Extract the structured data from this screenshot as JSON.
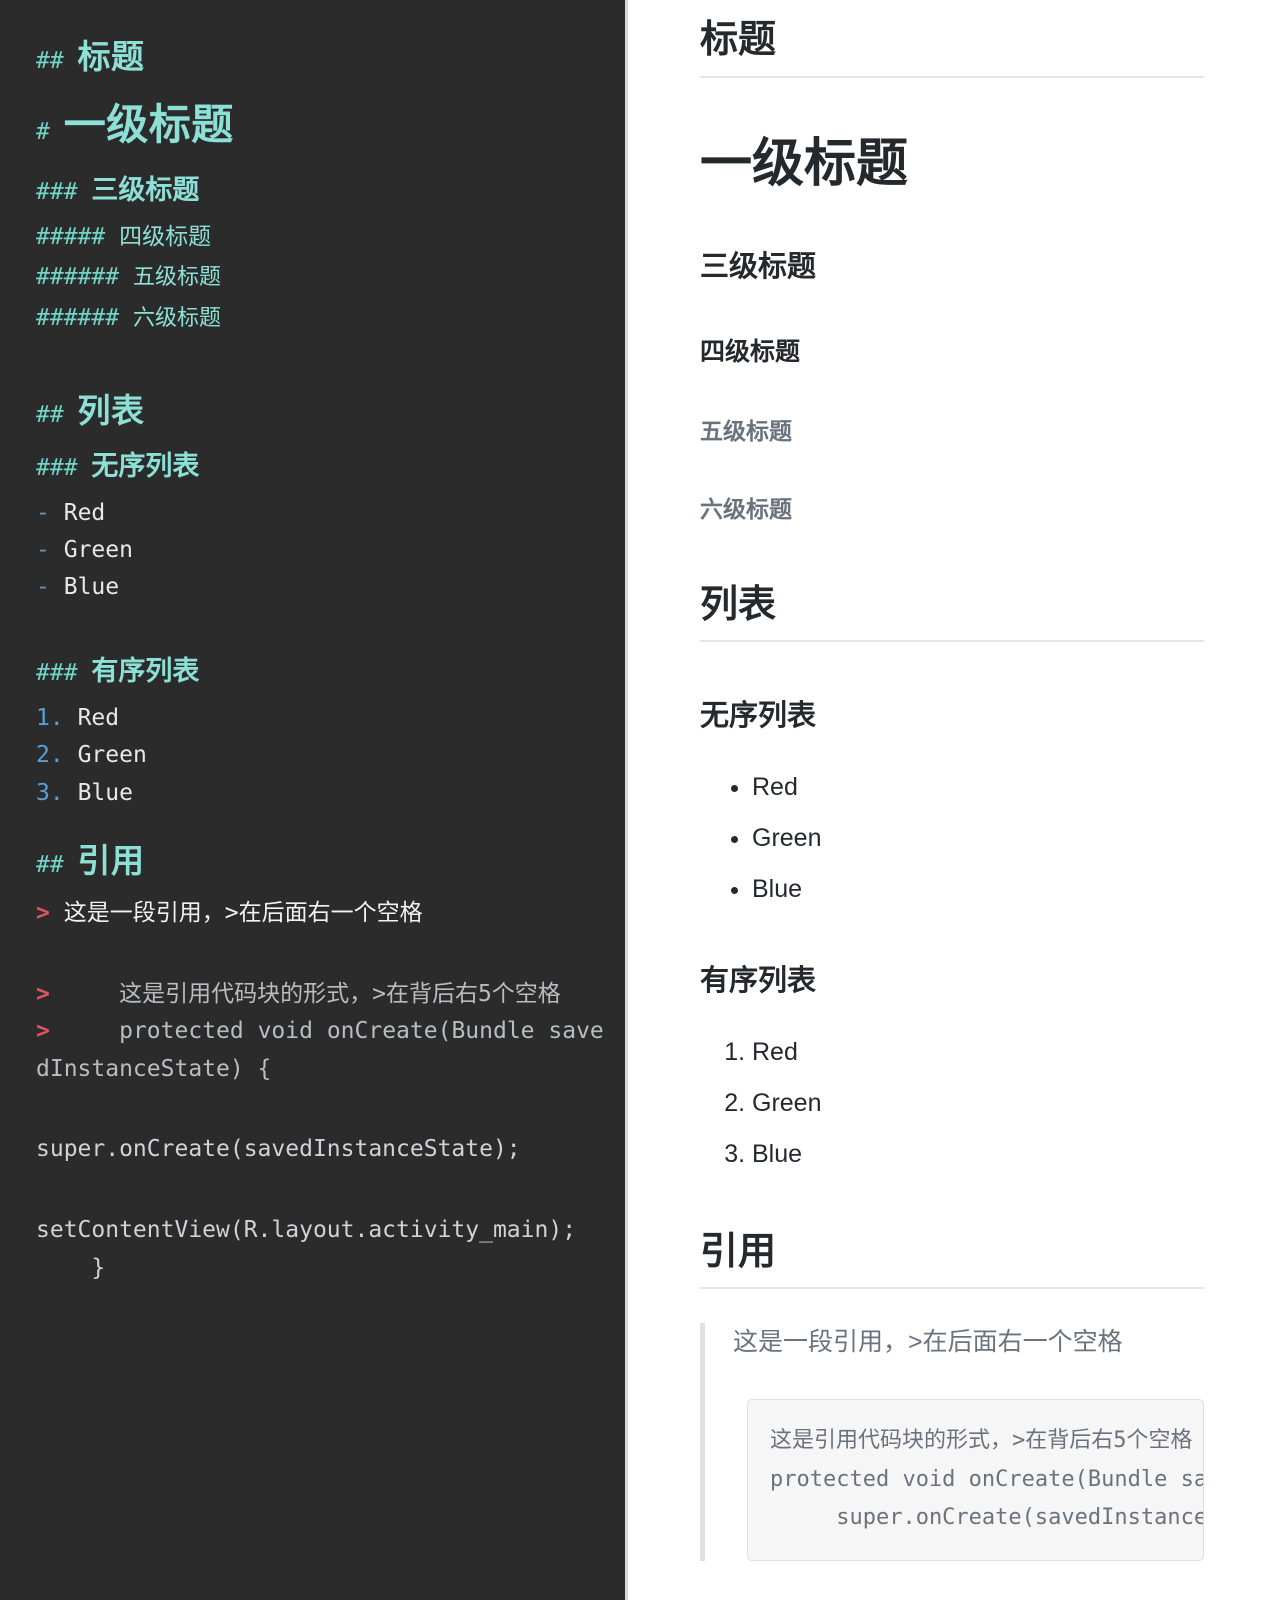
{
  "editor": {
    "theme_bg": "#2b2b2b",
    "heading_color": "#8ce0d6",
    "quote_marker_color": "#e05561",
    "ordered_marker_color": "#5a9fd4",
    "bullet_marker_color": "#6a8fb5",
    "lines": {
      "h2_biaoti_marks": "## ",
      "h2_biaoti_text": "标题",
      "h1_marks": "# ",
      "h1_text": "一级标题",
      "h3_marks": "### ",
      "h3_text": "三级标题",
      "h4_marks": "##### ",
      "h4_text": "四级标题",
      "h5_marks": "###### ",
      "h5_text": "五级标题",
      "h6_marks": "###### ",
      "h6_text": "六级标题",
      "h2_liebiao_marks": "## ",
      "h2_liebiao_text": "列表",
      "h3_unordered_marks": "### ",
      "h3_unordered_text": "无序列表",
      "ul_marker": "-",
      "ul_items": [
        "Red",
        "Green",
        "Blue"
      ],
      "h3_ordered_marks": "### ",
      "h3_ordered_text": "有序列表",
      "ol_markers": [
        "1.",
        "2.",
        "3."
      ],
      "ol_items": [
        "Red",
        "Green",
        "Blue"
      ],
      "h2_yinyong_marks": "## ",
      "h2_yinyong_text": "引用",
      "quote_marker": ">",
      "quote_line_1": "这是一段引用，>在后面右一个空格",
      "quote_block_line_1": "这是引用代码块的形式，>在背后右5个空格",
      "quote_block_line_1_indent": "     ",
      "quote_block_line_2": "protected void onCreate(Bundle savedInstanceState) {",
      "quote_block_line_2_indent": "     ",
      "code_line_3": "super.onCreate(savedInstanceState);",
      "code_line_4": "setContentView(R.layout.activity_main);",
      "code_line_5": "    }"
    }
  },
  "preview": {
    "bg": "#ffffff",
    "text_color": "#24292e",
    "muted_color": "#6a737d",
    "h2_biaoti": "标题",
    "h1": "一级标题",
    "h3": "三级标题",
    "h4": "四级标题",
    "h5": "五级标题",
    "h6": "六级标题",
    "h2_liebiao": "列表",
    "h3_unordered": "无序列表",
    "ul_items": [
      "Red",
      "Green",
      "Blue"
    ],
    "h3_ordered": "有序列表",
    "ol_items": [
      "Red",
      "Green",
      "Blue"
    ],
    "h2_yinyong": "引用",
    "quote_paragraph": "这是一段引用，>在后面右一个空格",
    "quote_code": "这是引用代码块的形式，>在背后右5个空格\nprotected void onCreate(Bundle savedInstanceState) {\n     super.onCreate(savedInstanceState);"
  }
}
